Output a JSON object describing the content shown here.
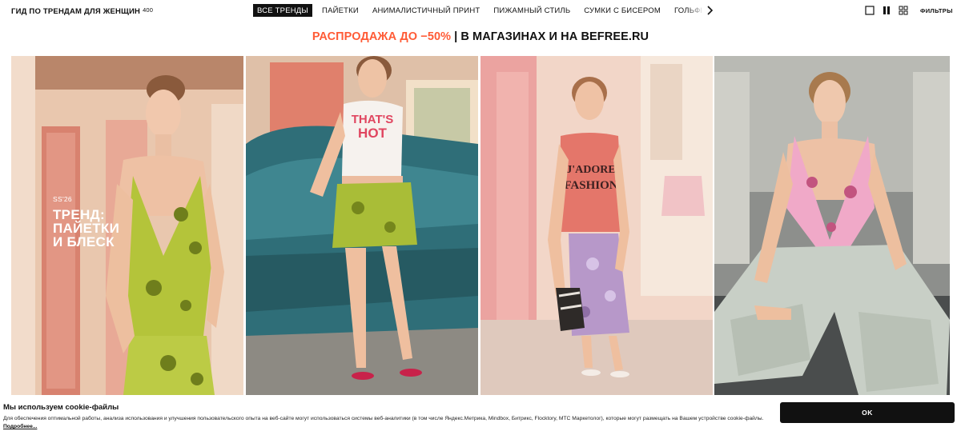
{
  "header": {
    "title": "ГИД ПО ТРЕНДАМ ДЛЯ ЖЕНЩИН",
    "count": "400",
    "tabs": [
      {
        "label": "ВСЕ ТРЕНДЫ",
        "active": true
      },
      {
        "label": "ПАЙЕТКИ",
        "active": false
      },
      {
        "label": "АНИМАЛИСТИЧНЫЙ ПРИНТ",
        "active": false
      },
      {
        "label": "ПИЖАМНЫЙ СТИЛЬ",
        "active": false
      },
      {
        "label": "СУМКИ С БИСЕРОМ",
        "active": false
      },
      {
        "label": "ГОЛЬФЫ БЕЗ МЫСА",
        "active": false
      },
      {
        "label": "",
        "active": false
      }
    ],
    "next_icon": "chevron-right-icon",
    "view_icons": [
      "single-column-view-icon",
      "two-column-view-icon",
      "grid-view-icon"
    ],
    "filters_label": "ФИЛЬТРЫ"
  },
  "promo": {
    "sale_text": "РАСПРОДАЖА ДО −50%",
    "separator": "|",
    "rest_text": "В МАГАЗИНАХ И НА BEFREE.RU",
    "sale_color": "#ff5b36"
  },
  "gallery": {
    "overlay": {
      "season": "SS'26",
      "trend_title": "ТРЕНД:\nПАЙЕТКИ\nИ БЛЕСК"
    },
    "cards": [
      {
        "name": "look-1",
        "shirt_text": ""
      },
      {
        "name": "look-2",
        "shirt_text": "THAT'S HOT"
      },
      {
        "name": "look-3",
        "shirt_text": "J'ADORE FASHION"
      },
      {
        "name": "look-4",
        "shirt_text": ""
      }
    ]
  },
  "cookie": {
    "title": "Мы используем cookie-файлы",
    "text": "Для обеспечения оптимальной работы, анализа использования и улучшения пользовательского опыта на веб-сайте могут использоваться системы веб-аналитики (в том числе Яндекс.Метрика, Mindbox, Битрикс, Flocktory, МТС Маркетолог), которые могут размещать на Вашем устройстве cookie-файлы.",
    "more_link": "Подробнее...",
    "ok_label": "OK"
  }
}
